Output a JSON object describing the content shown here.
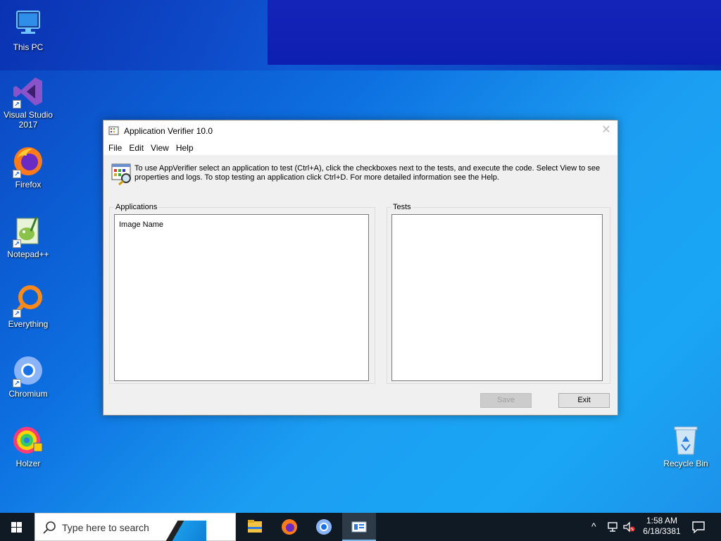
{
  "desktop": {
    "icons": [
      {
        "label": "This PC",
        "icon": "computer-icon"
      },
      {
        "label": "Visual Studio 2017",
        "icon": "visual-studio-icon"
      },
      {
        "label": "Firefox",
        "icon": "firefox-icon"
      },
      {
        "label": "Notepad++",
        "icon": "notepadpp-icon"
      },
      {
        "label": "Everything",
        "icon": "everything-search-icon"
      },
      {
        "label": "Chromium",
        "icon": "chromium-icon"
      },
      {
        "label": "Holzer",
        "icon": "holzer-icon"
      },
      {
        "label": "Recycle Bin",
        "icon": "recycle-bin-icon"
      }
    ]
  },
  "window": {
    "title": "Application Verifier 10.0",
    "menu": [
      "File",
      "Edit",
      "View",
      "Help"
    ],
    "info_text": "To use AppVerifier select an application to test (Ctrl+A), click the checkboxes next to the tests, and execute the code. Select View to see properties and logs. To stop testing an application click Ctrl+D. For more detailed information see the Help.",
    "applications": {
      "legend": "Applications",
      "column_header": "Image Name"
    },
    "tests": {
      "legend": "Tests"
    },
    "buttons": {
      "save": "Save",
      "exit": "Exit"
    },
    "close_glyph": "✕"
  },
  "taskbar": {
    "search_placeholder": "Type here to search",
    "apps": [
      "file-explorer-icon",
      "firefox-icon",
      "chromium-icon",
      "application-verifier-icon"
    ],
    "clock": {
      "time": "1:58 AM",
      "date": "6/18/3381"
    }
  },
  "colors": {
    "accent": "#0d6fe0",
    "taskbar": "#101a24"
  }
}
